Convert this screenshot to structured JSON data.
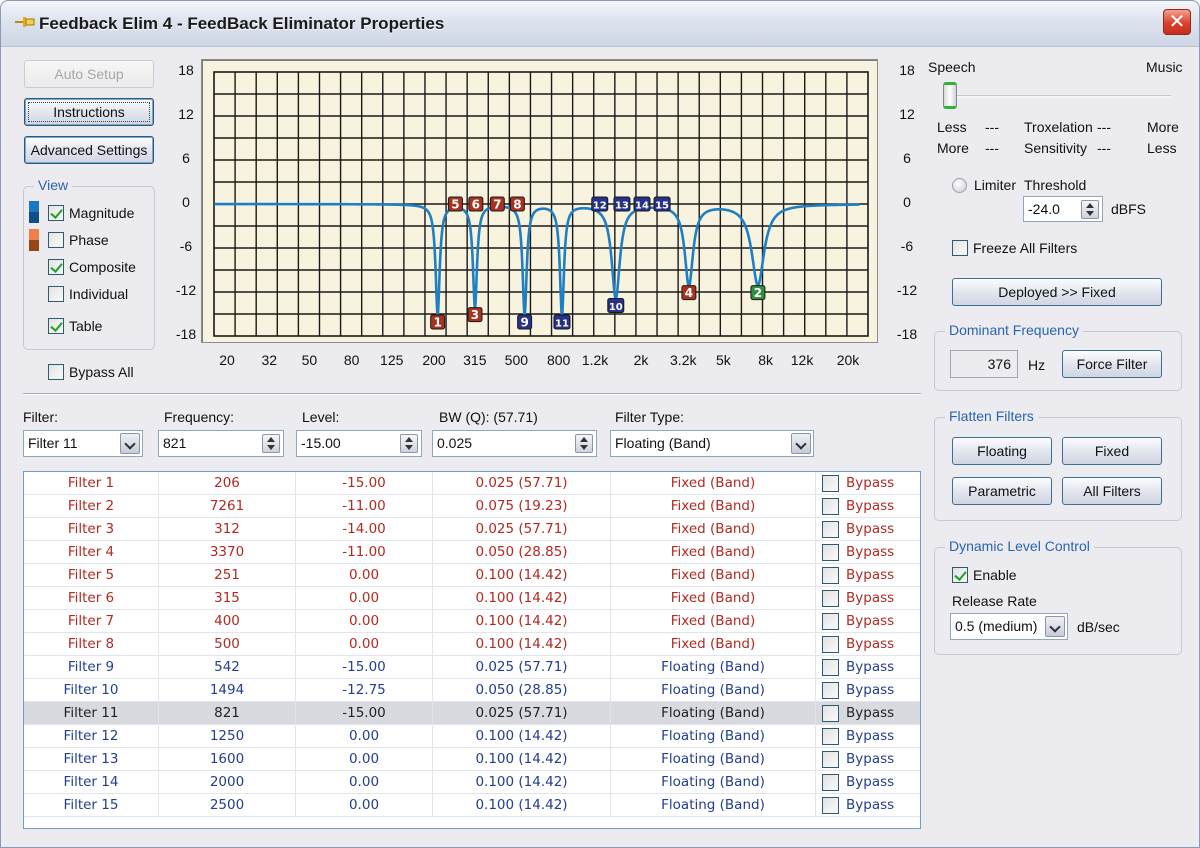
{
  "window": {
    "title": "Feedback Elim 4 - FeedBack Eliminator Properties",
    "pin_icon": "pin-icon",
    "close_icon": "close-icon"
  },
  "left_panel": {
    "auto_setup": "Auto Setup",
    "instructions": "Instructions",
    "advanced_settings": "Advanced Settings",
    "view_group": "View",
    "view_items": [
      {
        "label": "Magnitude",
        "checked": true
      },
      {
        "label": "Phase",
        "checked": false
      },
      {
        "label": "Composite",
        "checked": true
      },
      {
        "label": "Individual",
        "checked": false
      },
      {
        "label": "Table",
        "checked": true
      }
    ],
    "magnitude_colors": [
      "#1a78c2",
      "#0d4f86"
    ],
    "phase_colors": [
      "#f0804a",
      "#9a4514"
    ],
    "bypass_all": "Bypass All",
    "bypass_all_checked": false
  },
  "chart_data": {
    "type": "line",
    "title": "",
    "xlabel": "",
    "ylabel": "",
    "x_scale": "log",
    "x_tick_labels": [
      "20",
      "32",
      "50",
      "80",
      "125",
      "200",
      "315",
      "500",
      "800",
      "1.2k",
      "2k",
      "3.2k",
      "5k",
      "8k",
      "12k",
      "20k"
    ],
    "x_tick_values": [
      20,
      32,
      50,
      80,
      125,
      200,
      315,
      500,
      800,
      1200,
      2000,
      3200,
      5000,
      8000,
      12000,
      20000
    ],
    "y_tick_labels_left": [
      "18",
      "12",
      "6",
      "0",
      "-6",
      "-12",
      "-18"
    ],
    "y_tick_labels_right": [
      "18",
      "12",
      "6",
      "0",
      "-6",
      "-12",
      "-18"
    ],
    "ylim": [
      -18,
      18
    ],
    "xlim": [
      12,
      32000
    ],
    "grid": true,
    "background": "#f8f3df",
    "line_color": "#1f7fc4",
    "series": [
      {
        "name": "Composite Magnitude",
        "type": "sum of notch filters",
        "filters_ref": "filters.rows"
      }
    ],
    "markers": [
      {
        "id": "1",
        "freq": 206,
        "level": -15.0,
        "kind": "fixed"
      },
      {
        "id": "2",
        "freq": 7261,
        "level": -11.0,
        "kind": "fixed-green"
      },
      {
        "id": "3",
        "freq": 312,
        "level": -14.0,
        "kind": "fixed"
      },
      {
        "id": "4",
        "freq": 3370,
        "level": -11.0,
        "kind": "fixed"
      },
      {
        "id": "5",
        "freq": 251,
        "level": 0.0,
        "kind": "fixed"
      },
      {
        "id": "6",
        "freq": 315,
        "level": 0.0,
        "kind": "fixed"
      },
      {
        "id": "7",
        "freq": 400,
        "level": 0.0,
        "kind": "fixed"
      },
      {
        "id": "8",
        "freq": 500,
        "level": 0.0,
        "kind": "fixed"
      },
      {
        "id": "9",
        "freq": 542,
        "level": -15.0,
        "kind": "floating"
      },
      {
        "id": "10",
        "freq": 1494,
        "level": -12.75,
        "kind": "floating"
      },
      {
        "id": "11",
        "freq": 821,
        "level": -15.0,
        "kind": "floating"
      },
      {
        "id": "12",
        "freq": 1250,
        "level": 0.0,
        "kind": "floating"
      },
      {
        "id": "13",
        "freq": 1600,
        "level": 0.0,
        "kind": "floating"
      },
      {
        "id": "14",
        "freq": 2000,
        "level": 0.0,
        "kind": "floating"
      },
      {
        "id": "15",
        "freq": 2500,
        "level": 0.0,
        "kind": "floating"
      }
    ],
    "marker_colors": {
      "fixed": "#a8321e",
      "floating": "#27328a",
      "fixed-green": "#2f8f3e"
    }
  },
  "right_panel": {
    "speech": "Speech",
    "music": "Music",
    "slider_value": 0.0,
    "row1": [
      "Less",
      "---",
      "Troxelation",
      "---",
      "More"
    ],
    "row2": [
      "More",
      "---",
      "Sensitivity",
      "---",
      "Less"
    ],
    "limiter": "Limiter",
    "threshold": "Threshold",
    "threshold_value": "-24.0",
    "threshold_unit": "dBFS",
    "freeze_all": "Freeze All Filters",
    "freeze_checked": false,
    "deployed_fixed": "Deployed >> Fixed",
    "dominant_group": "Dominant Frequency",
    "dominant_value": "376",
    "dominant_unit": "Hz",
    "force_filter": "Force Filter",
    "flatten_group": "Flatten Filters",
    "flatten_buttons": [
      "Floating",
      "Fixed",
      "Parametric",
      "All Filters"
    ],
    "dlc_group": "Dynamic Level Control",
    "enable": "Enable",
    "enable_checked": true,
    "release_rate": "Release Rate",
    "release_value": "0.5 (medium)",
    "release_unit": "dB/sec"
  },
  "editor": {
    "filter_label": "Filter:",
    "filter_value": "Filter 11",
    "frequency_label": "Frequency:",
    "frequency_value": "821",
    "level_label": "Level:",
    "level_value": "-15.00",
    "bw_label": "BW (Q): (57.71)",
    "bw_value": "0.025",
    "type_label": "Filter Type:",
    "type_value": "Floating (Band)"
  },
  "filters": {
    "selected_index": 10,
    "bypass_label": "Bypass",
    "rows": [
      {
        "name": "Filter 1",
        "freq": "206",
        "level": "-15.00",
        "bw": "0.025 (57.71)",
        "type": "Fixed (Band)",
        "bypass": false
      },
      {
        "name": "Filter 2",
        "freq": "7261",
        "level": "-11.00",
        "bw": "0.075 (19.23)",
        "type": "Fixed (Band)",
        "bypass": false
      },
      {
        "name": "Filter 3",
        "freq": "312",
        "level": "-14.00",
        "bw": "0.025 (57.71)",
        "type": "Fixed (Band)",
        "bypass": false
      },
      {
        "name": "Filter 4",
        "freq": "3370",
        "level": "-11.00",
        "bw": "0.050 (28.85)",
        "type": "Fixed (Band)",
        "bypass": false
      },
      {
        "name": "Filter 5",
        "freq": "251",
        "level": "0.00",
        "bw": "0.100 (14.42)",
        "type": "Fixed (Band)",
        "bypass": false
      },
      {
        "name": "Filter 6",
        "freq": "315",
        "level": "0.00",
        "bw": "0.100 (14.42)",
        "type": "Fixed (Band)",
        "bypass": false
      },
      {
        "name": "Filter 7",
        "freq": "400",
        "level": "0.00",
        "bw": "0.100 (14.42)",
        "type": "Fixed (Band)",
        "bypass": false
      },
      {
        "name": "Filter 8",
        "freq": "500",
        "level": "0.00",
        "bw": "0.100 (14.42)",
        "type": "Fixed (Band)",
        "bypass": false
      },
      {
        "name": "Filter 9",
        "freq": "542",
        "level": "-15.00",
        "bw": "0.025 (57.71)",
        "type": "Floating (Band)",
        "bypass": false
      },
      {
        "name": "Filter 10",
        "freq": "1494",
        "level": "-12.75",
        "bw": "0.050 (28.85)",
        "type": "Floating (Band)",
        "bypass": false
      },
      {
        "name": "Filter 11",
        "freq": "821",
        "level": "-15.00",
        "bw": "0.025 (57.71)",
        "type": "Floating (Band)",
        "bypass": false
      },
      {
        "name": "Filter 12",
        "freq": "1250",
        "level": "0.00",
        "bw": "0.100 (14.42)",
        "type": "Floating (Band)",
        "bypass": false
      },
      {
        "name": "Filter 13",
        "freq": "1600",
        "level": "0.00",
        "bw": "0.100 (14.42)",
        "type": "Floating (Band)",
        "bypass": false
      },
      {
        "name": "Filter 14",
        "freq": "2000",
        "level": "0.00",
        "bw": "0.100 (14.42)",
        "type": "Floating (Band)",
        "bypass": false
      },
      {
        "name": "Filter 15",
        "freq": "2500",
        "level": "0.00",
        "bw": "0.100 (14.42)",
        "type": "Floating (Band)",
        "bypass": false
      }
    ]
  }
}
